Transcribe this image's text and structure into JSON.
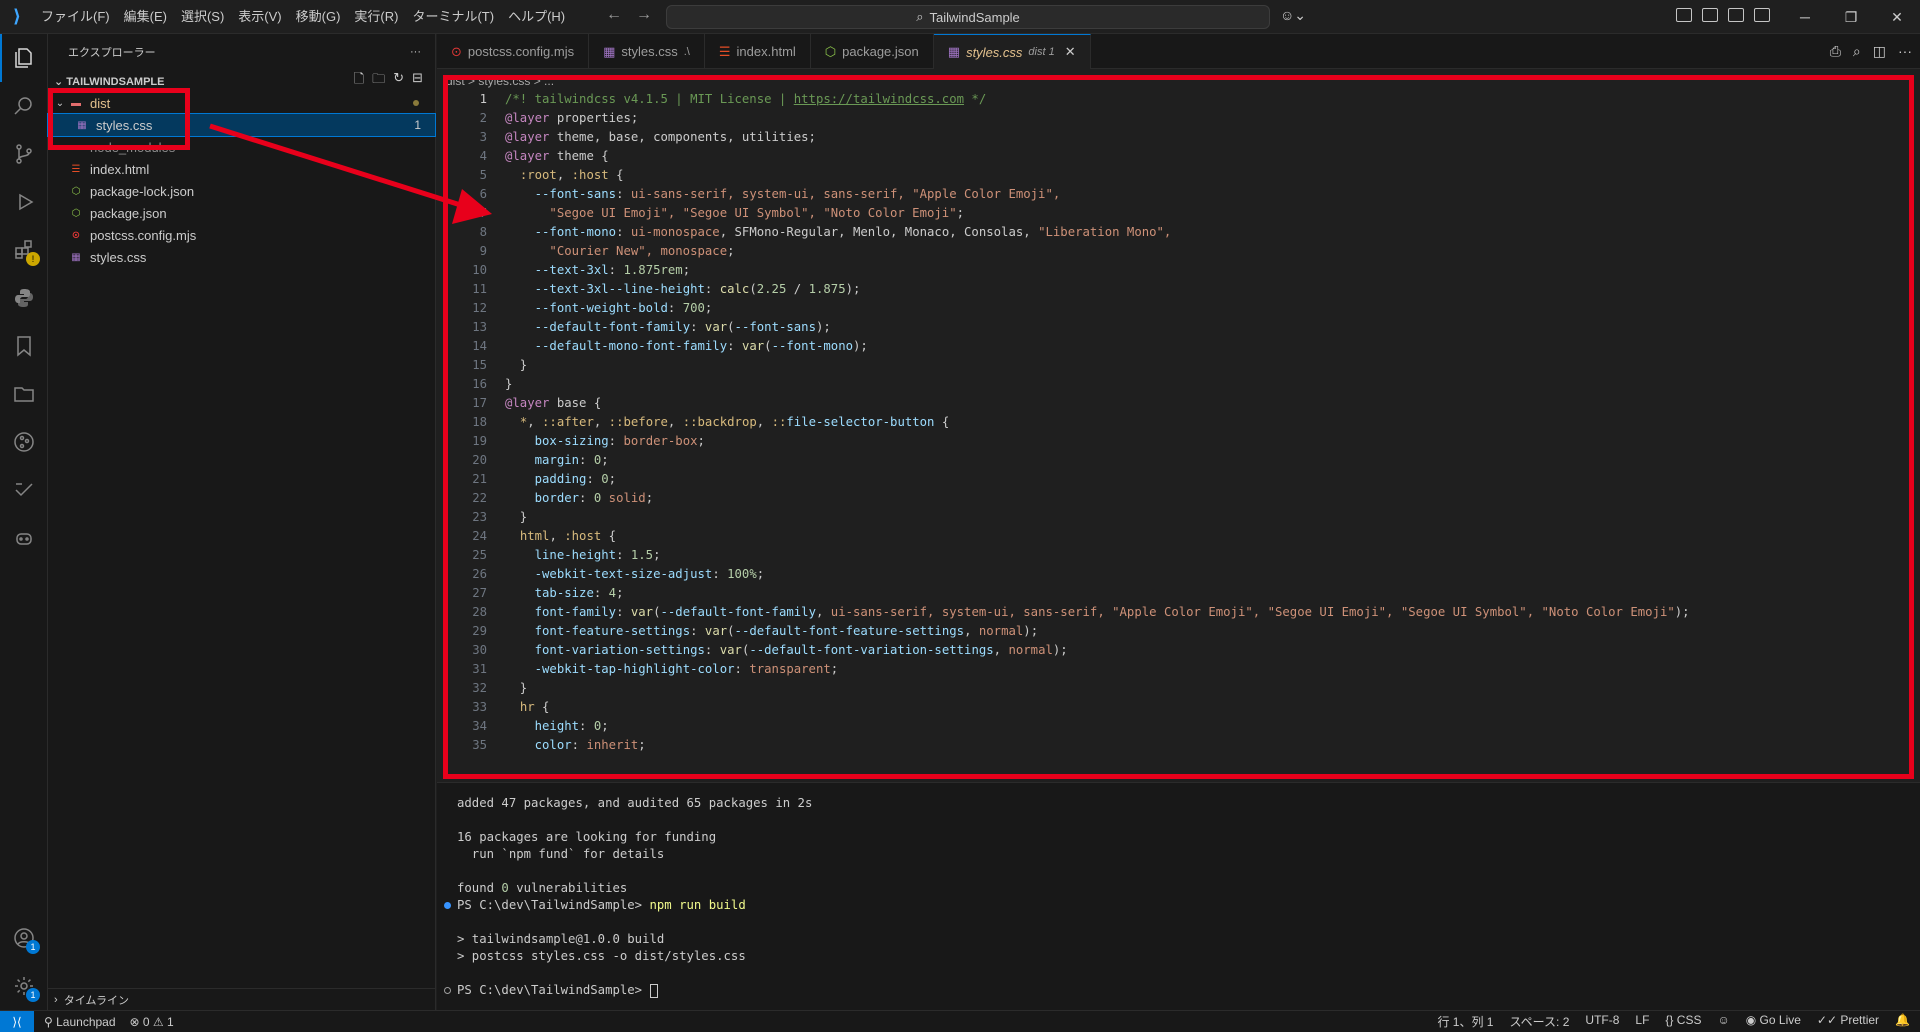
{
  "titlebar": {
    "menu": [
      "ファイル(F)",
      "編集(E)",
      "選択(S)",
      "表示(V)",
      "移動(G)",
      "実行(R)",
      "ターミナル(T)",
      "ヘルプ(H)"
    ],
    "search_text": "TailwindSample",
    "back_icon": "arrow-left-icon",
    "forward_icon": "arrow-right-icon"
  },
  "sidebar": {
    "title": "エクスプローラー",
    "root": "TAILWINDSAMPLE",
    "items": [
      {
        "label": "dist",
        "type": "folder-open",
        "color": "#e2c08d"
      },
      {
        "label": "styles.css",
        "type": "css",
        "badge": "1"
      },
      {
        "label": "node_modules",
        "type": "folder"
      },
      {
        "label": "index.html",
        "type": "html"
      },
      {
        "label": "package-lock.json",
        "type": "json"
      },
      {
        "label": "package.json",
        "type": "json"
      },
      {
        "label": "postcss.config.mjs",
        "type": "mjs"
      },
      {
        "label": "styles.css",
        "type": "css"
      }
    ],
    "timeline": "タイムライン"
  },
  "tabs": [
    {
      "label": "postcss.config.mjs",
      "icon": "postcss-icon"
    },
    {
      "label": "styles.css",
      "sub": ".\\",
      "icon": "css-icon"
    },
    {
      "label": "index.html",
      "icon": "html-icon"
    },
    {
      "label": "package.json",
      "icon": "json-icon"
    },
    {
      "label": "styles.css",
      "sub": "dist 1",
      "icon": "css-icon",
      "active": true
    }
  ],
  "breadcrumb": "dist > styles.css > ...",
  "editor": {
    "current_line": 1,
    "line_count": 35
  },
  "terminal": {
    "lines": [
      {
        "text": "added 47 packages, and audited 65 packages in 2s"
      },
      {
        "text": ""
      },
      {
        "text": "16 packages are looking for funding"
      },
      {
        "text": "  run `npm fund` for details"
      },
      {
        "text": ""
      },
      {
        "text": "found 0 vulnerabilities"
      },
      {
        "text": "PS C:\\dev\\TailwindSample> ",
        "cmd": "npm run build",
        "dot": "blue"
      },
      {
        "text": ""
      },
      {
        "text": "> tailwindsample@1.0.0 build"
      },
      {
        "text": "> postcss styles.css -o dist/styles.css"
      },
      {
        "text": ""
      },
      {
        "text": "PS C:\\dev\\TailwindSample> ",
        "dot": "hollow",
        "cursor": true
      }
    ]
  },
  "statusbar": {
    "launchpad": "Launchpad",
    "problems": "⊗ 0 ⚠ 1",
    "position": "行 1、列 1",
    "spaces": "スペース: 2",
    "encoding": "UTF-8",
    "eol": "LF",
    "language": "CSS",
    "golive": "Go Live",
    "prettier": "Prettier"
  },
  "annotation_color": "#e8001b"
}
